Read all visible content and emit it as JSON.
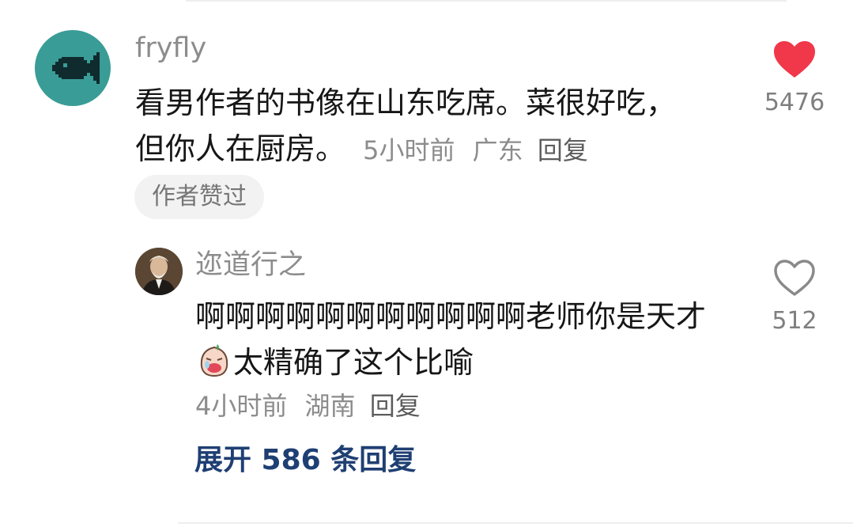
{
  "main_comment": {
    "username": "fryfly",
    "text": "看男作者的书像在山东吃席。菜很好吃，但你人在厨房。",
    "time": "5小时前",
    "location": "广东",
    "reply_label": "回复",
    "badge": "作者赞过",
    "like_count": "5476",
    "liked": true
  },
  "reply_comment": {
    "username": "迩道行之",
    "text_part1": "啊啊啊啊啊啊啊啊啊啊啊老师你是天才",
    "text_part2": "太精确了这个比喻",
    "time": "4小时前",
    "location": "湖南",
    "reply_label": "回复",
    "like_count": "512",
    "liked": false
  },
  "expand_label": "展开 586 条回复",
  "colors": {
    "heart_liked": "#f0384a",
    "avatar_bg": "#3a9c97",
    "expand_link": "#1f3f73"
  }
}
